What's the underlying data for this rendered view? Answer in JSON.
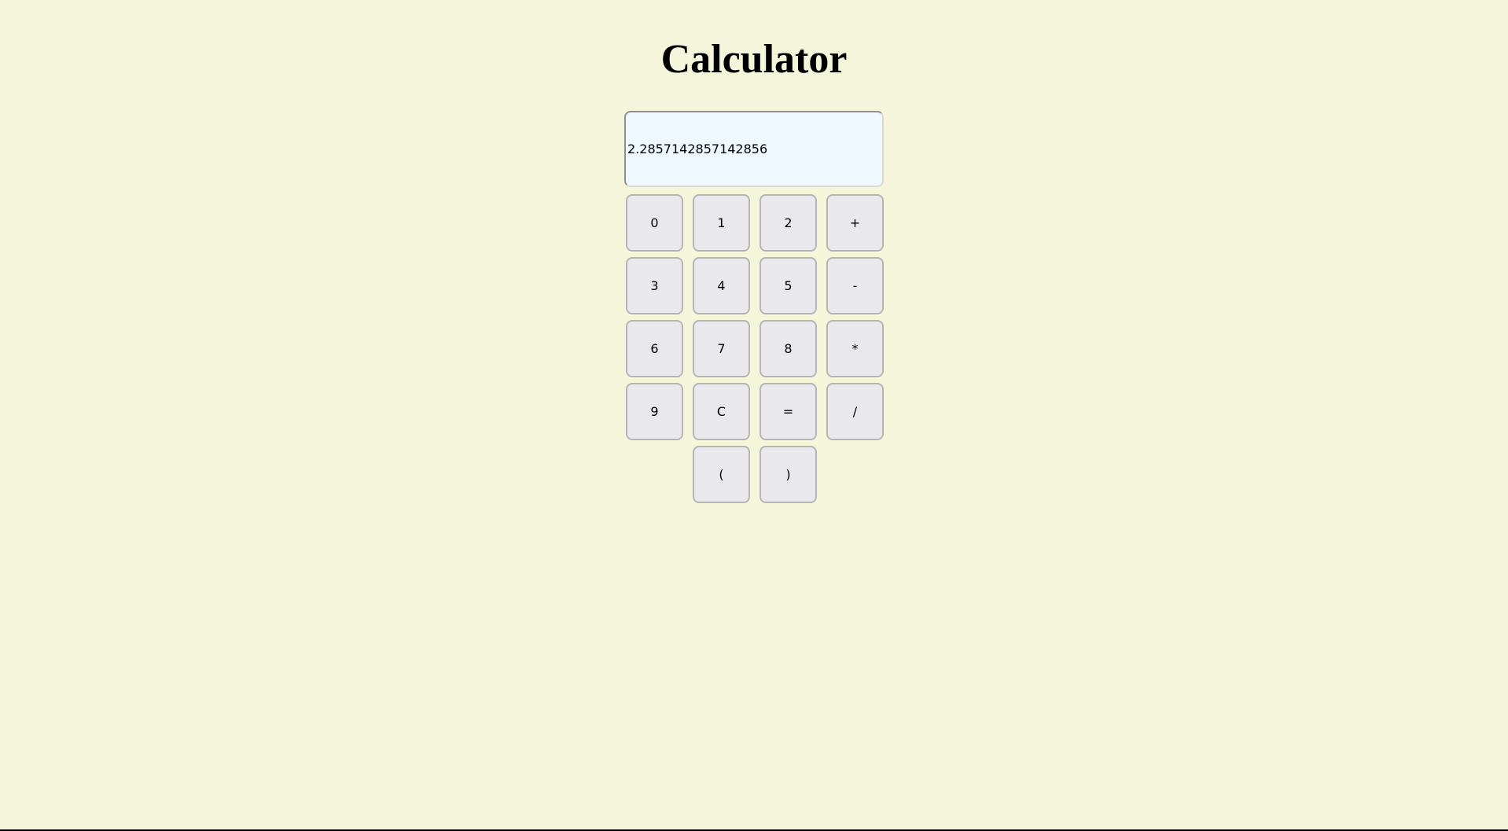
{
  "title": "Calculator",
  "display": {
    "value": "2.2857142857142856"
  },
  "keys": [
    [
      "0",
      "1",
      "2",
      "+"
    ],
    [
      "3",
      "4",
      "5",
      "-"
    ],
    [
      "6",
      "7",
      "8",
      "*"
    ],
    [
      "9",
      "C",
      "=",
      "/"
    ],
    [
      "",
      "(",
      ")",
      ""
    ]
  ],
  "colors": {
    "background": "#f5f5dc",
    "display_background": "#f0f8ff",
    "key_background": "#e9e9ed"
  }
}
